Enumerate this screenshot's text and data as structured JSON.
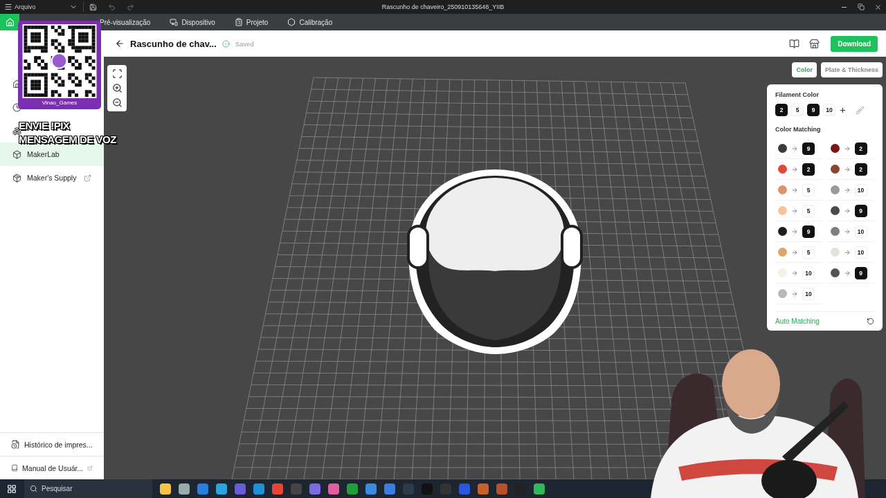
{
  "window": {
    "title": "Rascunho de chaveiro_250910135648_YIIB",
    "menu": "Arquivo"
  },
  "nav": {
    "home": {
      "selected": true
    },
    "tabs": [
      {
        "label": "Pré-visualização",
        "selected": false
      },
      {
        "label": "Dispositivo",
        "selected": false
      },
      {
        "label": "Projeto",
        "selected": false
      },
      {
        "label": "Calibração",
        "selected": false
      }
    ]
  },
  "stream_overlay": {
    "qr_caption": "Vinao_Games",
    "alert_lines": [
      "ENVIE !PIX",
      "MENSAGEM DE VOZ"
    ]
  },
  "sidebar": {
    "items": [
      {
        "label": "MakerLab",
        "selected": true
      },
      {
        "label": "Maker's Supply",
        "selected": false,
        "external": true
      }
    ],
    "footer_items": [
      {
        "label": "Histórico de impres...",
        "external": false
      },
      {
        "label": "Manual de Usuár...",
        "external": true
      }
    ]
  },
  "header": {
    "title": "Rascunho de chav...",
    "status": "Saved",
    "download": "Download"
  },
  "panel": {
    "tabs": [
      {
        "label": "Color",
        "selected": true
      },
      {
        "label": "Plate & Thickness",
        "selected": false
      }
    ],
    "filament_title": "Filament Color",
    "filaments": [
      {
        "label": "2",
        "color": "#111111"
      },
      {
        "label": "5",
        "color": "#ffffff"
      },
      {
        "label": "9",
        "color": "#111111"
      },
      {
        "label": "10",
        "color": "#ffffff"
      }
    ],
    "matching_title": "Color Matching",
    "matches": [
      {
        "color": "#3b3b3b",
        "target": "9",
        "target_dark": true
      },
      {
        "color": "#7a1616",
        "target": "2",
        "target_dark": true
      },
      {
        "color": "#e0483a",
        "target": "2",
        "target_dark": true
      },
      {
        "color": "#8b4530",
        "target": "2",
        "target_dark": true
      },
      {
        "color": "#d9956b",
        "target": "5",
        "target_dark": false
      },
      {
        "color": "#9a9a9a",
        "target": "10",
        "target_dark": false
      },
      {
        "color": "#f5c59a",
        "target": "5",
        "target_dark": false
      },
      {
        "color": "#4a4a4a",
        "target": "9",
        "target_dark": true
      },
      {
        "color": "#1e1e1e",
        "target": "9",
        "target_dark": true
      },
      {
        "color": "#7e7e7e",
        "target": "10",
        "target_dark": false
      },
      {
        "color": "#dba86a",
        "target": "5",
        "target_dark": false
      },
      {
        "color": "#e2e2d8",
        "target": "10",
        "target_dark": false
      },
      {
        "color": "#f6f2e8",
        "target": "10",
        "target_dark": false
      },
      {
        "color": "#555555",
        "target": "9",
        "target_dark": true
      },
      {
        "color": "#b8b8b8",
        "target": "10",
        "target_dark": false
      }
    ],
    "auto_matching": "Auto Matching"
  },
  "taskbar": {
    "search_placeholder": "Pesquisar"
  }
}
